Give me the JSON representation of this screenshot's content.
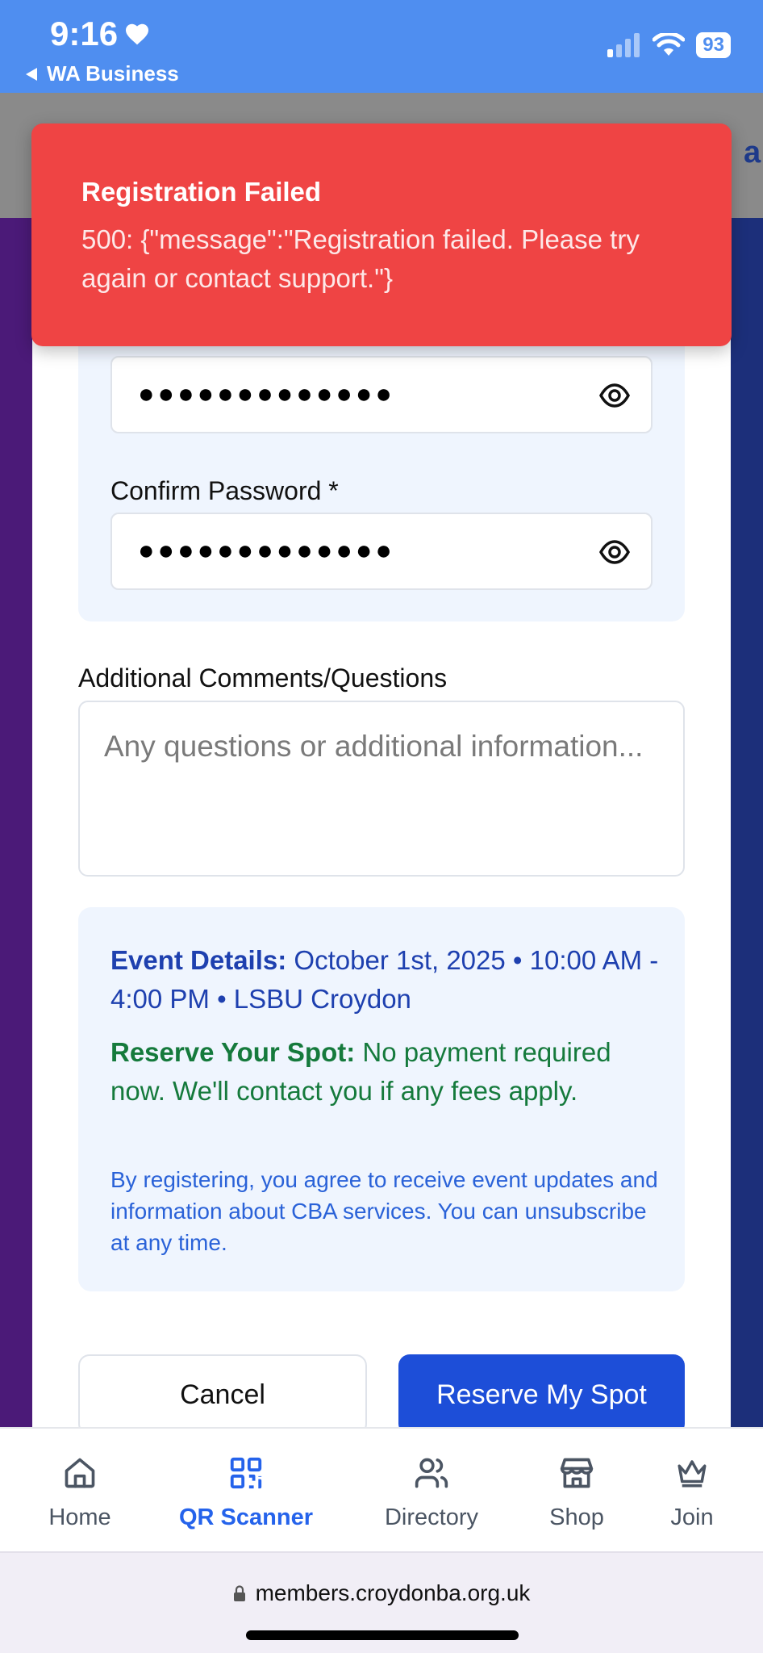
{
  "status_bar": {
    "time": "9:16",
    "back_label": "WA Business",
    "battery": "93"
  },
  "background": {
    "peek_text": "a"
  },
  "toast": {
    "title": "Registration Failed",
    "message": "500: {\"message\":\"Registration failed. Please try again or contact support.\"}"
  },
  "form": {
    "password_value": "●●●●●●●●●●●●●",
    "confirm_label": "Confirm Password *",
    "confirm_value": "●●●●●●●●●●●●●",
    "comments_label": "Additional Comments/Questions",
    "comments_placeholder": "Any questions or additional information..."
  },
  "info": {
    "event_heading": "Event Details:",
    "event_text": "October 1st, 2025 • 10:00 AM - 4:00 PM • LSBU Croydon",
    "reserve_heading": "Reserve Your Spot:",
    "reserve_text": "No payment required now. We'll contact you if any fees apply.",
    "consent_text": "By registering, you agree to receive event updates and information about CBA services. You can unsubscribe at any time."
  },
  "buttons": {
    "cancel": "Cancel",
    "reserve": "Reserve My Spot"
  },
  "tabs": [
    {
      "label": "Home",
      "icon": "home-icon",
      "active": false
    },
    {
      "label": "QR Scanner",
      "icon": "qr-code-icon",
      "active": true
    },
    {
      "label": "Directory",
      "icon": "users-icon",
      "active": false
    },
    {
      "label": "Shop",
      "icon": "store-icon",
      "active": false
    },
    {
      "label": "Join",
      "icon": "crown-icon",
      "active": false
    }
  ],
  "url_bar": {
    "url": "members.croydonba.org.uk"
  },
  "colors": {
    "status_bar": "#4f8ef0",
    "toast": "#ef4444",
    "primary": "#1d4ed8",
    "active_tab": "#2563eb"
  }
}
